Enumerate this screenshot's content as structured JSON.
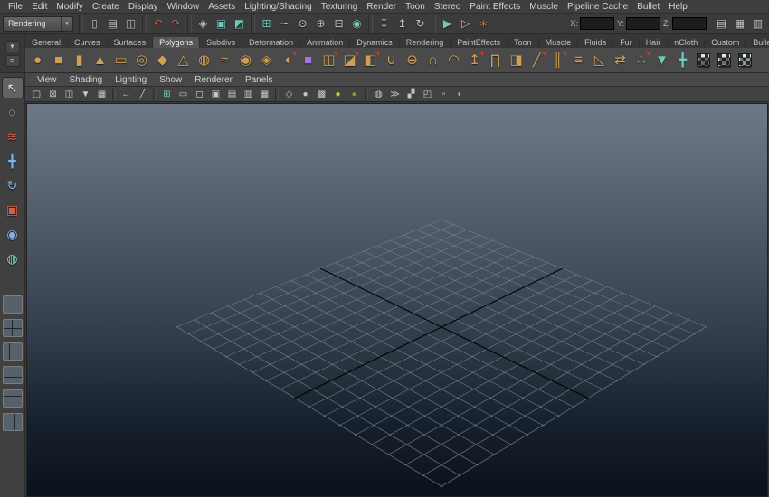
{
  "colors": {
    "ui_background": "#3e3e3e",
    "shelf_background": "#4a4a4a",
    "active_tab": "#565656",
    "viewport_top": "#6e7987",
    "viewport_bottom": "#0a111b",
    "grid_line": "#afbac7",
    "grid_axis": "#04070b",
    "shelf_icon_gold": "#cfa052",
    "shelf_icon_purple": "#a871e8",
    "accent_red": "#d0604e",
    "accent_teal": "#73c7ba"
  },
  "menubar": {
    "items": [
      {
        "label": "File"
      },
      {
        "label": "Edit"
      },
      {
        "label": "Modify"
      },
      {
        "label": "Create"
      },
      {
        "label": "Display"
      },
      {
        "label": "Window"
      },
      {
        "label": "Assets"
      },
      {
        "label": "Lighting/Shading"
      },
      {
        "label": "Texturing"
      },
      {
        "label": "Render"
      },
      {
        "label": "Toon"
      },
      {
        "label": "Stereo"
      },
      {
        "label": "Paint Effects"
      },
      {
        "label": "Muscle"
      },
      {
        "label": "Pipeline Cache"
      },
      {
        "label": "Bullet"
      },
      {
        "label": "Help"
      }
    ]
  },
  "statusline": {
    "mode": "Rendering",
    "scene_group": [
      {
        "name": "new-scene-icon",
        "glyph": "▯",
        "kind": ""
      },
      {
        "name": "open-scene-icon",
        "glyph": "▤",
        "kind": ""
      },
      {
        "name": "save-scene-icon",
        "glyph": "◫",
        "kind": ""
      }
    ],
    "edit_group": [
      {
        "name": "undo-icon",
        "glyph": "↶",
        "kind": "accent-red"
      },
      {
        "name": "redo-icon",
        "glyph": "↷",
        "kind": "accent-red"
      }
    ],
    "selection_group": [
      {
        "name": "select-hierarchy-icon",
        "glyph": "◈",
        "kind": ""
      },
      {
        "name": "select-object-icon",
        "glyph": "▣",
        "kind": "accent-teal"
      },
      {
        "name": "select-component-icon",
        "glyph": "◩",
        "kind": "accent-teal"
      }
    ],
    "snap_group": [
      {
        "name": "snap-to-grid-icon",
        "glyph": "⊞",
        "kind": "accent-teal"
      },
      {
        "name": "snap-to-curves-icon",
        "glyph": "∼",
        "kind": ""
      },
      {
        "name": "snap-to-points-icon",
        "glyph": "⊙",
        "kind": ""
      },
      {
        "name": "snap-to-projected-center-icon",
        "glyph": "⊕",
        "kind": ""
      },
      {
        "name": "snap-to-view-planes-icon",
        "glyph": "⊟",
        "kind": ""
      },
      {
        "name": "make-live-icon",
        "glyph": "◉",
        "kind": "accent-teal"
      }
    ],
    "history_group": [
      {
        "name": "inputs-to-selected-icon",
        "glyph": "↧",
        "kind": ""
      },
      {
        "name": "outputs-from-selected-icon",
        "glyph": "↥",
        "kind": ""
      },
      {
        "name": "construction-history-icon",
        "glyph": "↻",
        "kind": ""
      }
    ],
    "render_group": [
      {
        "name": "render-current-frame-icon",
        "glyph": "▶",
        "kind": "accent-teal"
      },
      {
        "name": "ipr-render-icon",
        "glyph": "▷",
        "kind": ""
      },
      {
        "name": "render-settings-icon",
        "glyph": "∗",
        "kind": "accent-red"
      }
    ],
    "fields": [
      {
        "label": "X:",
        "name": "x-coordinate-input"
      },
      {
        "label": "Y:",
        "name": "y-coordinate-input"
      },
      {
        "label": "Z:",
        "name": "z-coordinate-input"
      }
    ],
    "sidebar_group": [
      {
        "name": "attribute-editor-toggle-icon",
        "glyph": "▤",
        "kind": ""
      },
      {
        "name": "tool-settings-toggle-icon",
        "glyph": "▦",
        "kind": ""
      },
      {
        "name": "channel-box-toggle-icon",
        "glyph": "▥",
        "kind": ""
      }
    ]
  },
  "shelf": {
    "menu_button_glyph": "▾",
    "editor_button_glyph": "≡",
    "tabs": [
      {
        "label": "General",
        "state": ""
      },
      {
        "label": "Curves",
        "state": ""
      },
      {
        "label": "Surfaces",
        "state": ""
      },
      {
        "label": "Polygons",
        "state": "active"
      },
      {
        "label": "Subdivs",
        "state": ""
      },
      {
        "label": "Deformation",
        "state": ""
      },
      {
        "label": "Animation",
        "state": ""
      },
      {
        "label": "Dynamics",
        "state": ""
      },
      {
        "label": "Rendering",
        "state": ""
      },
      {
        "label": "PaintEffects",
        "state": ""
      },
      {
        "label": "Toon",
        "state": ""
      },
      {
        "label": "Muscle",
        "state": ""
      },
      {
        "label": "Fluids",
        "state": ""
      },
      {
        "label": "Fur",
        "state": ""
      },
      {
        "label": "Hair",
        "state": ""
      },
      {
        "label": "nCloth",
        "state": ""
      },
      {
        "label": "Custom",
        "state": ""
      },
      {
        "label": "Bullet",
        "state": ""
      }
    ],
    "icons": [
      {
        "name": "poly-sphere-icon",
        "glyph": "●",
        "kind": "gold"
      },
      {
        "name": "poly-cube-icon",
        "glyph": "■",
        "kind": "gold"
      },
      {
        "name": "poly-cylinder-icon",
        "glyph": "▮",
        "kind": "gold"
      },
      {
        "name": "poly-cone-icon",
        "glyph": "▲",
        "kind": "gold"
      },
      {
        "name": "poly-plane-icon",
        "glyph": "▭",
        "kind": "gold"
      },
      {
        "name": "poly-torus-icon",
        "glyph": "◎",
        "kind": "gold"
      },
      {
        "name": "poly-prism-icon",
        "glyph": "◆",
        "kind": "gold"
      },
      {
        "name": "poly-pyramid-icon",
        "glyph": "△",
        "kind": "gold"
      },
      {
        "name": "poly-pipe-icon",
        "glyph": "◍",
        "kind": "gold"
      },
      {
        "name": "poly-helix-icon",
        "glyph": "≈",
        "kind": "gold"
      },
      {
        "name": "poly-soccer-ball-icon",
        "glyph": "◉",
        "kind": "gold"
      },
      {
        "name": "poly-platonic-solid-icon",
        "glyph": "◈",
        "kind": "gold"
      },
      {
        "name": "sculpt-geometry-icon",
        "glyph": "◖",
        "kind": "gold-red"
      },
      {
        "name": "smooth-proxy-icon",
        "glyph": "■",
        "kind": "purple"
      },
      {
        "name": "combine-icon",
        "glyph": "◫",
        "kind": "gold-red"
      },
      {
        "name": "separate-icon",
        "glyph": "◪",
        "kind": "gold-red"
      },
      {
        "name": "extract-icon",
        "glyph": "◧",
        "kind": "gold-red"
      },
      {
        "name": "boolean-union-icon",
        "glyph": "∪",
        "kind": "gold"
      },
      {
        "name": "boolean-difference-icon",
        "glyph": "⊖",
        "kind": "gold"
      },
      {
        "name": "boolean-intersection-icon",
        "glyph": "∩",
        "kind": "gold"
      },
      {
        "name": "smooth-icon",
        "glyph": "◠",
        "kind": "gold"
      },
      {
        "name": "extrude-icon",
        "glyph": "↥",
        "kind": "gold-red"
      },
      {
        "name": "bridge-icon",
        "glyph": "∏",
        "kind": "gold"
      },
      {
        "name": "append-to-polygon-icon",
        "glyph": "◨",
        "kind": "gold"
      },
      {
        "name": "split-polygon-icon",
        "glyph": "╱",
        "kind": "gold-red"
      },
      {
        "name": "insert-edge-loop-icon",
        "glyph": "║",
        "kind": "gold-red"
      },
      {
        "name": "offset-edge-loop-icon",
        "glyph": "≡",
        "kind": "gold"
      },
      {
        "name": "bevel-icon",
        "glyph": "◺",
        "kind": "gold"
      },
      {
        "name": "mirror-geometry-icon",
        "glyph": "⇄",
        "kind": "gold"
      },
      {
        "name": "merge-vertices-icon",
        "glyph": "∴",
        "kind": "gold-red"
      },
      {
        "name": "sculpt-tool-icon",
        "glyph": "▼",
        "kind": "teal"
      },
      {
        "name": "paint-3d-tool-icon",
        "glyph": "╋",
        "kind": "teal"
      },
      {
        "name": "uv-checker-map-icon",
        "glyph": "▩",
        "kind": "checker"
      },
      {
        "name": "uv-texture-editor-icon",
        "glyph": "▦",
        "kind": "checker"
      },
      {
        "name": "uv-snapshot-icon",
        "glyph": "▨",
        "kind": "checker"
      }
    ]
  },
  "toolbox": {
    "tools": [
      {
        "name": "select-tool-icon",
        "glyph": "↖",
        "kind": "white",
        "state": "active"
      },
      {
        "name": "lasso-tool-icon",
        "glyph": "◌",
        "kind": "white",
        "state": ""
      },
      {
        "name": "paint-selection-tool-icon",
        "glyph": "≋",
        "kind": "red",
        "state": ""
      },
      {
        "name": "move-tool-icon",
        "glyph": "╋",
        "kind": "blue",
        "state": ""
      },
      {
        "name": "rotate-tool-icon",
        "glyph": "↻",
        "kind": "blue",
        "state": ""
      },
      {
        "name": "scale-tool-icon",
        "glyph": "▣",
        "kind": "red",
        "state": ""
      },
      {
        "name": "universal-manipulator-icon",
        "glyph": "◉",
        "kind": "blue",
        "state": ""
      },
      {
        "name": "soft-modification-icon",
        "glyph": "◍",
        "kind": "tealc",
        "state": ""
      }
    ],
    "layouts": [
      {
        "name": "layout-single-pane",
        "kind": "lt-single"
      },
      {
        "name": "layout-four-pane",
        "kind": "lt-four"
      },
      {
        "name": "layout-persp-outliner",
        "kind": "lt-left-split"
      },
      {
        "name": "layout-persp-graph",
        "kind": "lt-bottom-split"
      },
      {
        "name": "layout-hypershade-persp",
        "kind": "lt-top-split"
      },
      {
        "name": "layout-persp-uv",
        "kind": "lt-right-split"
      }
    ]
  },
  "panel": {
    "menus": [
      {
        "label": "View"
      },
      {
        "label": "Shading"
      },
      {
        "label": "Lighting"
      },
      {
        "label": "Show"
      },
      {
        "label": "Renderer"
      },
      {
        "label": "Panels"
      }
    ],
    "camera_group": [
      {
        "name": "select-camera-icon",
        "glyph": "▢",
        "kind": ""
      },
      {
        "name": "lock-camera-icon",
        "glyph": "⊠",
        "kind": ""
      },
      {
        "name": "camera-attributes-icon",
        "glyph": "◫",
        "kind": ""
      },
      {
        "name": "bookmarks-icon",
        "glyph": "▼",
        "kind": ""
      },
      {
        "name": "image-plane-icon",
        "glyph": "▦",
        "kind": ""
      }
    ],
    "view_group": [
      {
        "name": "pan-zoom-2d-icon",
        "glyph": "↔",
        "kind": ""
      },
      {
        "name": "grease-pencil-icon",
        "glyph": "╱",
        "kind": ""
      }
    ],
    "gate_group": [
      {
        "name": "grid-toggle-icon",
        "glyph": "⊞",
        "kind": "tealc"
      },
      {
        "name": "film-gate-icon",
        "glyph": "▭",
        "kind": ""
      },
      {
        "name": "resolution-gate-icon",
        "glyph": "◻",
        "kind": ""
      },
      {
        "name": "gate-mask-icon",
        "glyph": "▣",
        "kind": ""
      },
      {
        "name": "field-chart-icon",
        "glyph": "▤",
        "kind": ""
      },
      {
        "name": "safe-action-icon",
        "glyph": "▥",
        "kind": ""
      },
      {
        "name": "safe-title-icon",
        "glyph": "▦",
        "kind": ""
      }
    ],
    "shading_group": [
      {
        "name": "wireframe-icon",
        "glyph": "◇",
        "kind": ""
      },
      {
        "name": "smooth-shade-icon",
        "glyph": "●",
        "kind": ""
      },
      {
        "name": "textured-icon",
        "glyph": "▩",
        "kind": ""
      },
      {
        "name": "use-all-lights-icon",
        "glyph": "●",
        "kind": "yellow"
      },
      {
        "name": "shadows-icon",
        "glyph": "●",
        "kind": "olive"
      }
    ],
    "extras_group": [
      {
        "name": "screen-ao-icon",
        "glyph": "◍",
        "kind": ""
      },
      {
        "name": "motion-blur-icon",
        "glyph": "≫",
        "kind": ""
      },
      {
        "name": "multisample-icon",
        "glyph": "▞",
        "kind": ""
      },
      {
        "name": "isolate-select-icon",
        "glyph": "◰",
        "kind": ""
      },
      {
        "name": "xray-icon",
        "glyph": "▫",
        "kind": ""
      },
      {
        "name": "exposure-icon",
        "glyph": "◐",
        "kind": "tealc"
      }
    ]
  },
  "viewport": {
    "description": "perspective view with ground grid"
  }
}
